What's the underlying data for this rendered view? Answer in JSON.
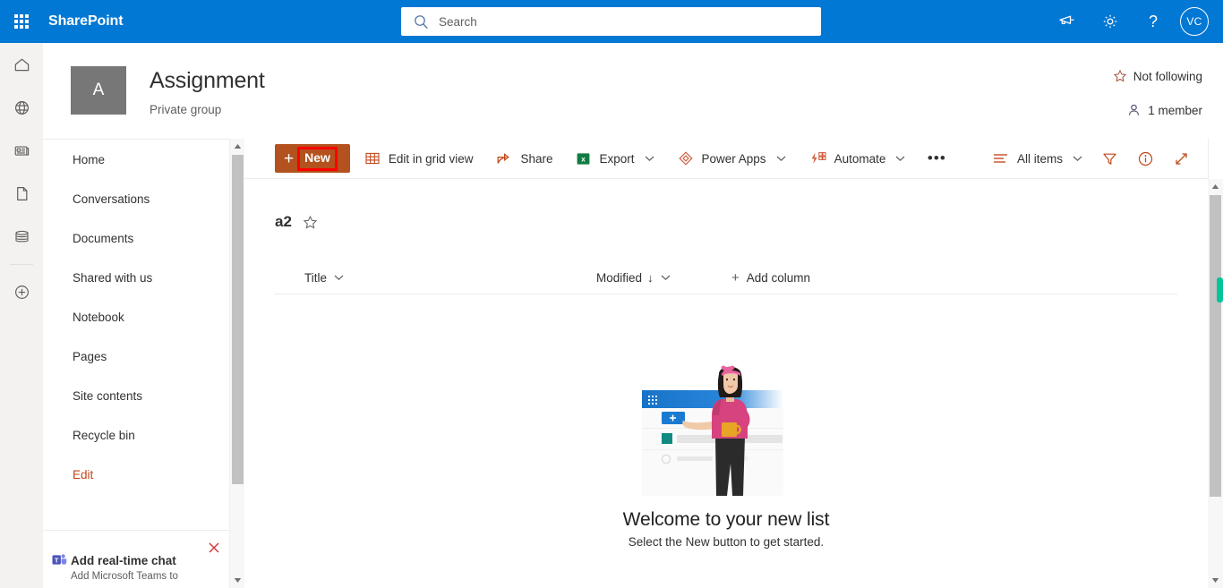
{
  "suite": {
    "waffle_icon": "waffle-grid-icon",
    "brand": "SharePoint",
    "search": {
      "placeholder": "Search",
      "value": "",
      "icon": "search-icon"
    },
    "actions": [
      {
        "name": "feedback-megaphone-icon",
        "label": "Feedback"
      },
      {
        "name": "settings-gear-icon",
        "label": "Settings"
      },
      {
        "name": "help-question-icon",
        "label": "Help"
      }
    ],
    "avatar_initials": "VC",
    "bar_color": "#0078d4"
  },
  "rail": {
    "items": [
      {
        "name": "home-icon",
        "label": "Home"
      },
      {
        "name": "globe-following-icon",
        "label": "Following"
      },
      {
        "name": "news-icon",
        "label": "News"
      },
      {
        "name": "document-icon",
        "label": "Documents"
      },
      {
        "name": "list-icon",
        "label": "Lists"
      },
      {
        "name": "create-plus-icon",
        "label": "Create"
      }
    ]
  },
  "site": {
    "logo_letter": "A",
    "logo_color": "#777777",
    "title": "Assignment",
    "subtitle": "Private group",
    "follow_label": "Not following",
    "follow_icon": "star-outline-icon",
    "member_label": "1 member",
    "member_icon": "person-icon"
  },
  "nav": {
    "items": [
      {
        "label": "Home"
      },
      {
        "label": "Conversations"
      },
      {
        "label": "Documents"
      },
      {
        "label": "Shared with us"
      },
      {
        "label": "Notebook"
      },
      {
        "label": "Pages"
      },
      {
        "label": "Site contents"
      },
      {
        "label": "Recycle bin"
      },
      {
        "label": "Edit"
      }
    ],
    "edit_color": "#c0461a"
  },
  "promo": {
    "title": "Add real-time chat",
    "subtitle": "Add Microsoft Teams to",
    "icon": "teams-icon",
    "close_icon": "close-icon",
    "close_color": "#d13438"
  },
  "toolbar": {
    "new_label": "New",
    "new_plus": "+",
    "new_color": "#b3521f",
    "highlight_color": "#ff0000",
    "commands": [
      {
        "label": "Edit in grid view",
        "icon": "grid-view-icon",
        "has_chevron": false
      },
      {
        "label": "Share",
        "icon": "share-icon",
        "has_chevron": false
      },
      {
        "label": "Export",
        "icon": "excel-icon",
        "has_chevron": true
      },
      {
        "label": "Power Apps",
        "icon": "power-apps-icon",
        "has_chevron": true
      },
      {
        "label": "Automate",
        "icon": "automate-icon",
        "has_chevron": true
      }
    ],
    "overflow_label": "•••",
    "view_label": "All items",
    "view_icon": "list-lines-icon",
    "right_icons": [
      {
        "name": "filter-funnel-icon",
        "label": "Filter"
      },
      {
        "name": "info-circle-icon",
        "label": "Details"
      },
      {
        "name": "expand-arrows-icon",
        "label": "Full screen"
      }
    ],
    "accent_color": "#c0461a"
  },
  "list": {
    "title": "a2",
    "favorite_icon": "star-outline-icon",
    "columns": [
      {
        "label": "Title",
        "sorted": false
      },
      {
        "label": "Modified",
        "sorted": true,
        "sort_arrow": "↓"
      }
    ],
    "add_column_label": "Add column",
    "add_column_plus": "+",
    "empty_state": {
      "heading": "Welcome to your new list",
      "description": "Select the New button to get started.",
      "illustration": "person-with-list-illustration"
    }
  },
  "scrollbars": {
    "nav": {
      "up": "▲",
      "down": "▼"
    },
    "page": {
      "up": "▲",
      "down": "▼",
      "marker_color": "#00c39a"
    }
  }
}
